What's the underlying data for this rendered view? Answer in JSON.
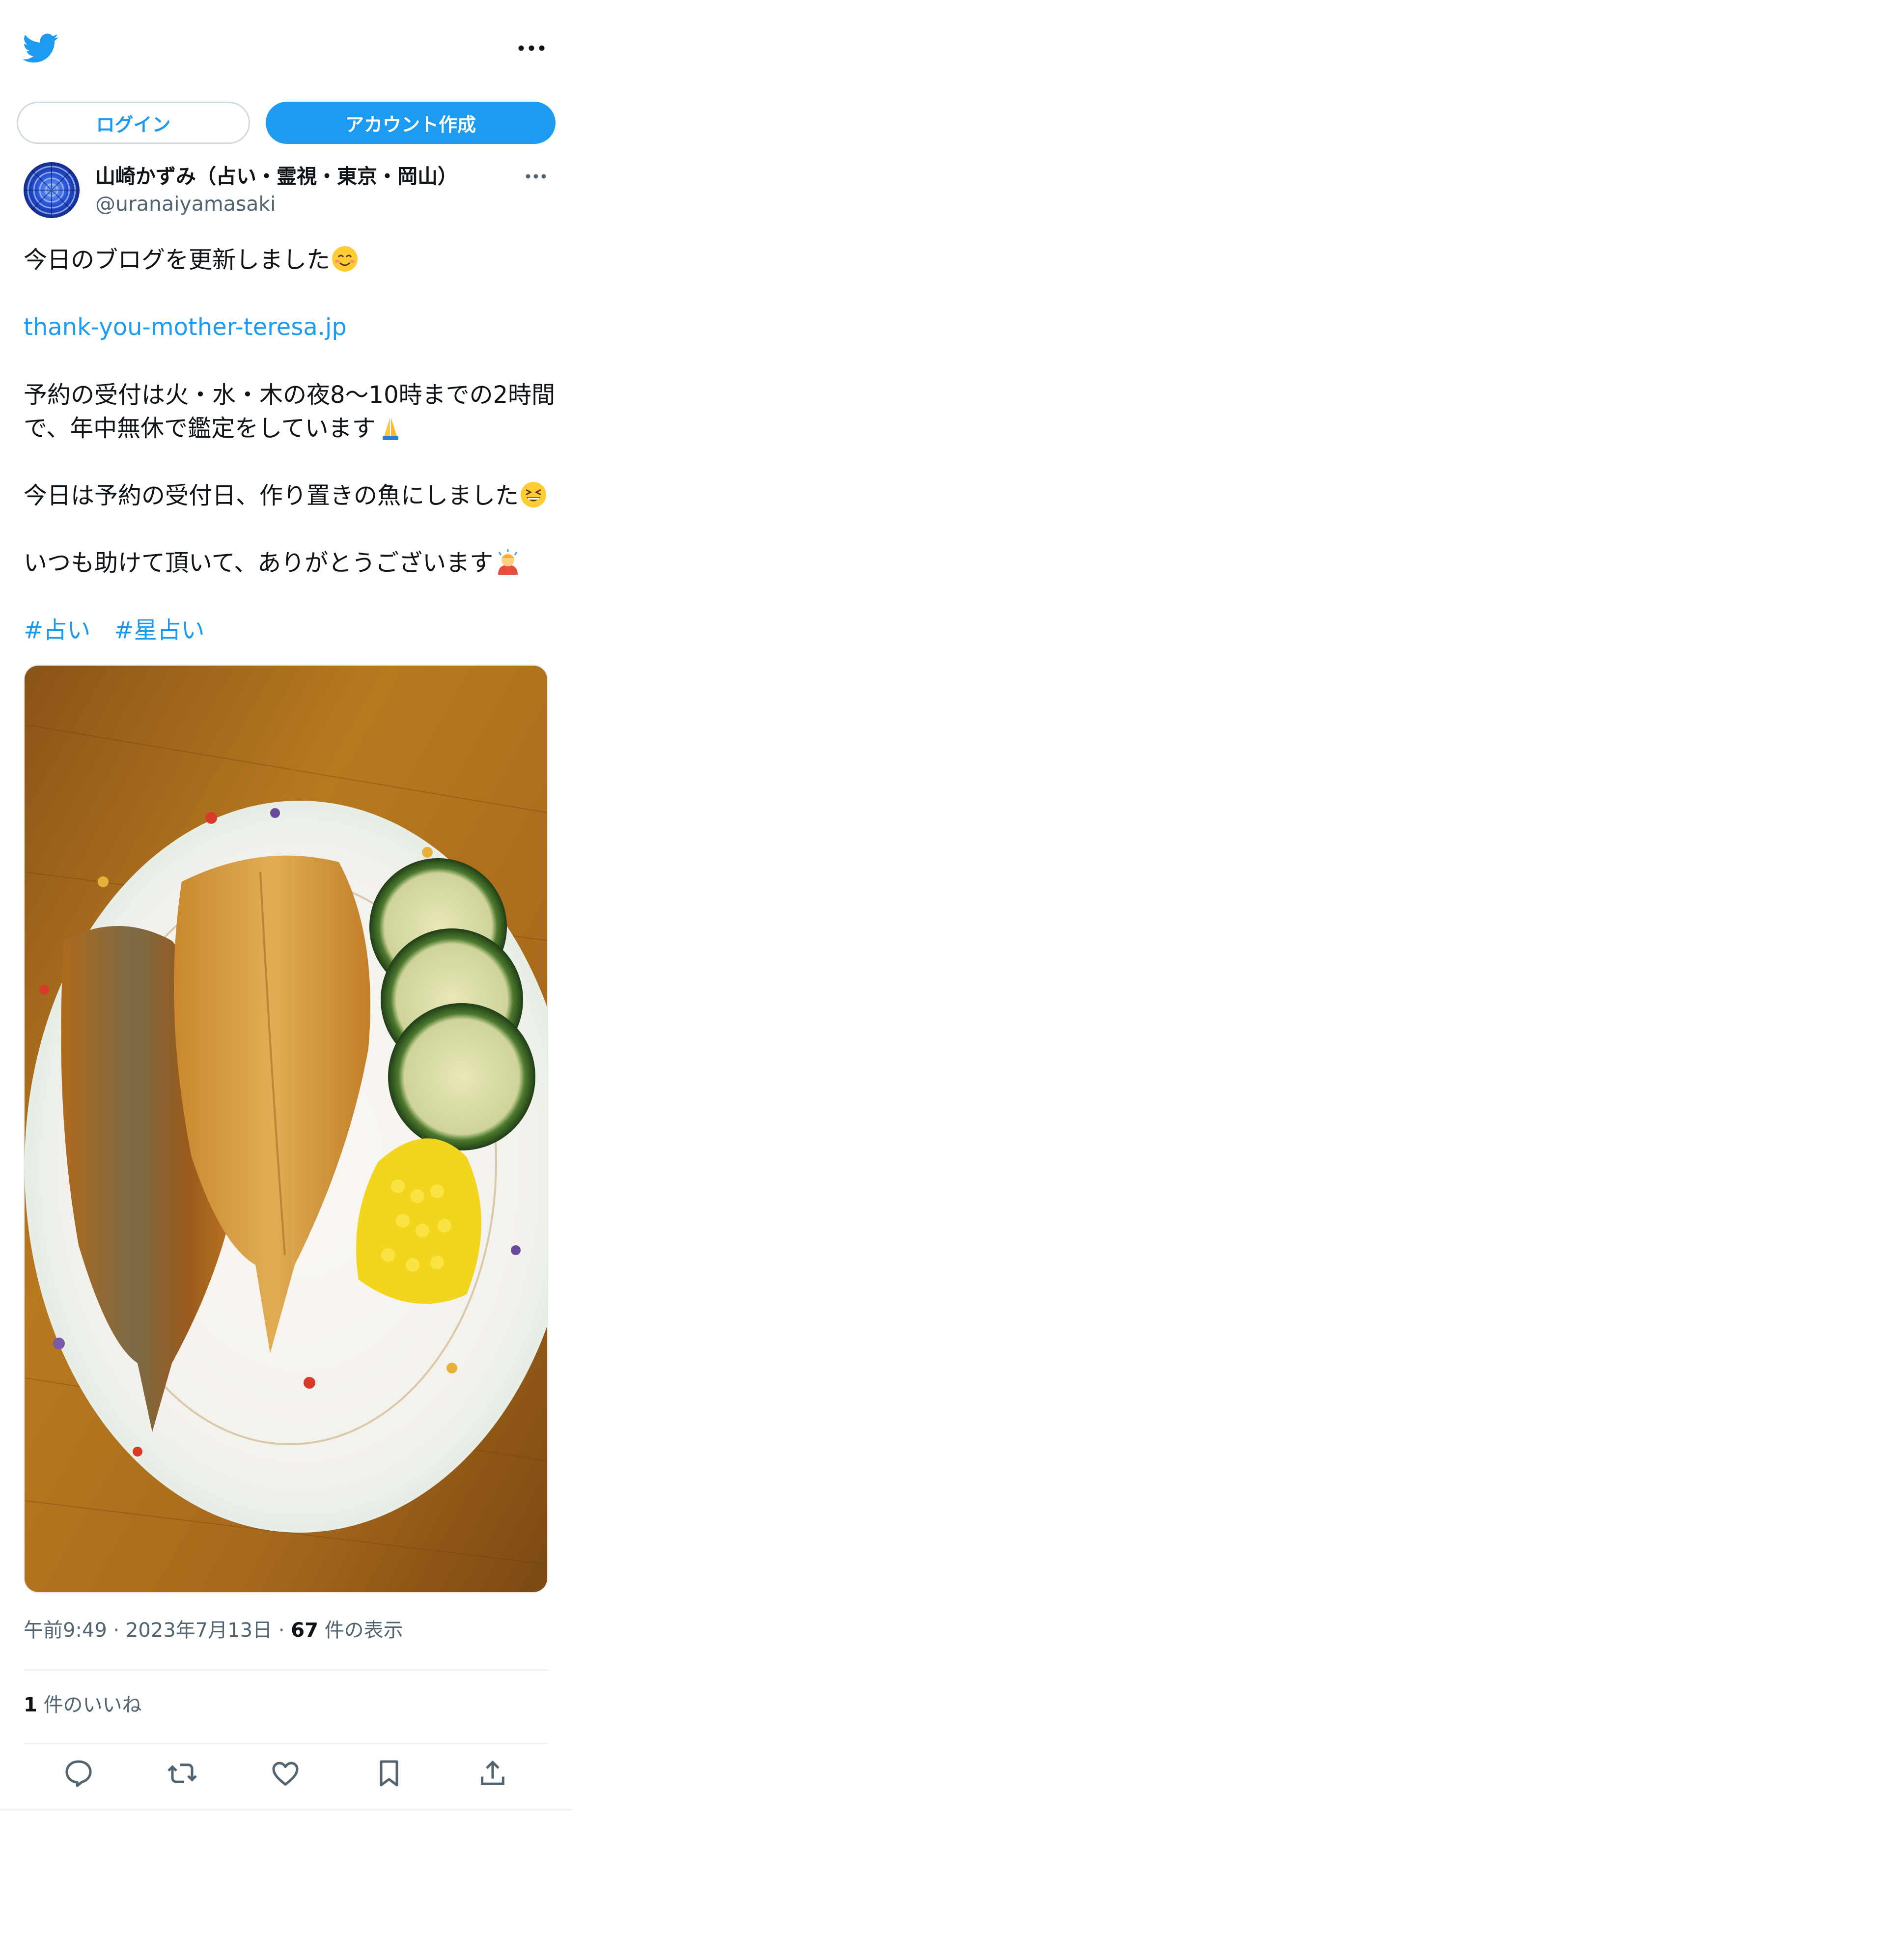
{
  "header": {
    "logo": "twitter-bird-icon",
    "menu_icon": "more-horizontal-icon"
  },
  "auth": {
    "login_label": "ログイン",
    "signup_label": "アカウント作成"
  },
  "tweet": {
    "author": {
      "avatar": "blue-flower-avatar",
      "display_name": "山崎かずみ（占い・霊視・東京・岡山）",
      "handle": "@uranaiyamasaki"
    },
    "lines": {
      "l1": "今日のブログを更新しました",
      "link": "thank-you-mother-teresa.jp",
      "l3": "予約の受付は火・水・木の夜8〜10時までの2時間",
      "l4": "で、年中無休で鑑定をしています",
      "l5": "今日は予約の受付日、作り置きの魚にしました",
      "l6": "いつも助けて頂いて、ありがとうございます",
      "hashtag1": "#占い",
      "hashtag2": "#星占い"
    },
    "emojis": [
      "smiling-face-emoji",
      "folded-hands-emoji",
      "grinning-squinting-face-emoji",
      "person-bowing-emoji"
    ],
    "photo": "fried-fish-plate-photo",
    "meta": {
      "time": "午前9:49",
      "date": "2023年7月13日",
      "separator": "·",
      "views_count": "67",
      "views_label": "件の表示"
    },
    "likes": {
      "count": "1",
      "label": "件のいいね"
    }
  },
  "actions": [
    "reply-icon",
    "retweet-icon",
    "like-icon",
    "bookmark-icon",
    "share-icon"
  ],
  "colors": {
    "accent": "#1d9bf0",
    "text": "#0f1419",
    "secondary": "#536471",
    "border": "#cfd9de"
  }
}
